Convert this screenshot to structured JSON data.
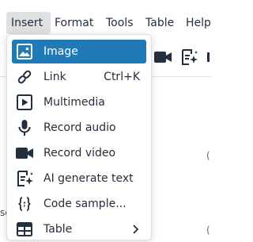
{
  "menubar": {
    "items": [
      {
        "label": "Insert",
        "active": true
      },
      {
        "label": "Format"
      },
      {
        "label": "Tools"
      },
      {
        "label": "Table"
      },
      {
        "label": "Help"
      }
    ]
  },
  "toolbar": {
    "icons": [
      "record-video-icon",
      "ai-generate-text-icon"
    ]
  },
  "insert_menu": {
    "items": [
      {
        "label": "Image",
        "icon": "image-icon",
        "selected": true
      },
      {
        "label": "Link",
        "icon": "link-icon",
        "shortcut": "Ctrl+K"
      },
      {
        "label": "Multimedia",
        "icon": "multimedia-icon"
      },
      {
        "label": "Record audio",
        "icon": "microphone-icon"
      },
      {
        "label": "Record video",
        "icon": "video-camera-icon"
      },
      {
        "label": "AI generate text",
        "icon": "ai-generate-text-icon"
      },
      {
        "label": "Code sample...",
        "icon": "code-sample-icon"
      },
      {
        "label": "Table",
        "icon": "table-icon",
        "submenu": true
      }
    ]
  },
  "background": {
    "editor_text_fragment": "sc",
    "right_glyph_1": "(",
    "right_glyph_2": "("
  },
  "colors": {
    "accent": "#207ab7",
    "active_menubar_bg": "#dee0e2",
    "text": "#222f3e"
  }
}
